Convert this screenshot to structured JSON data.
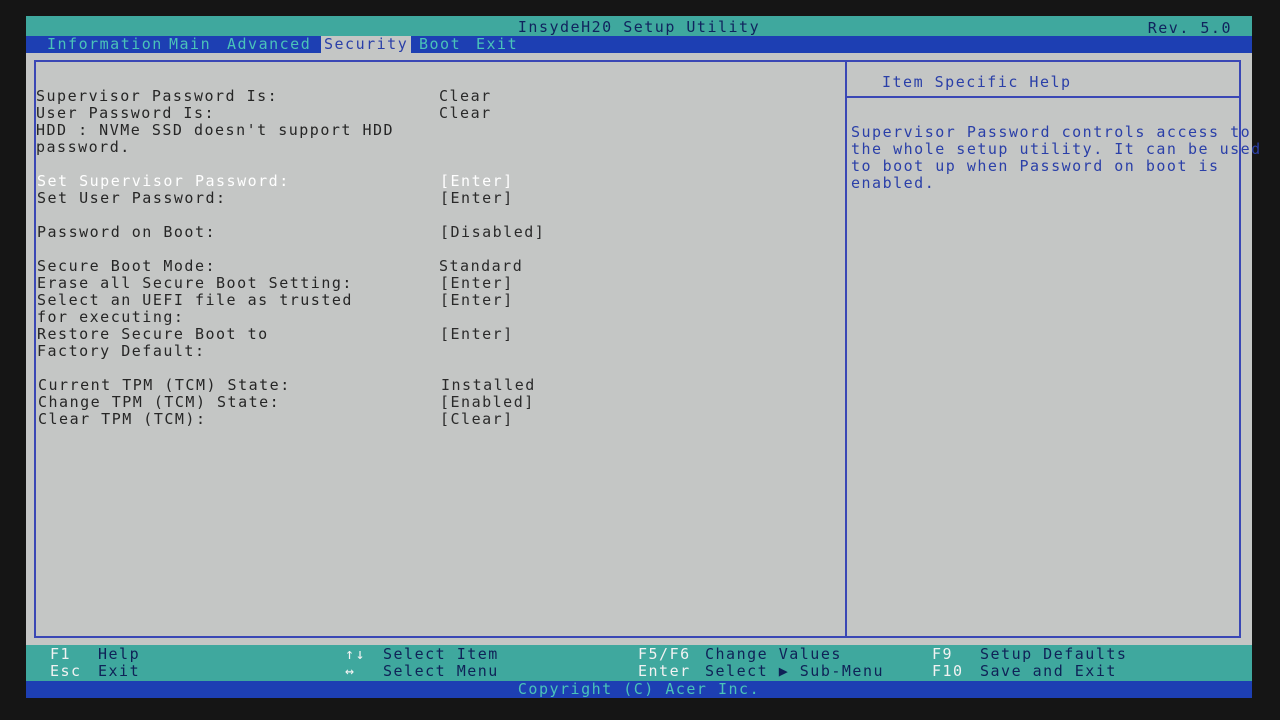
{
  "header": {
    "title": "InsydeH20 Setup Utility",
    "revision": "Rev. 5.0"
  },
  "menu": {
    "tabs": [
      {
        "label": "Information"
      },
      {
        "label": "Main"
      },
      {
        "label": "Advanced"
      },
      {
        "label": "Security"
      },
      {
        "label": "Boot"
      },
      {
        "label": "Exit"
      }
    ],
    "active": "Security"
  },
  "security": {
    "supervisor_pw_status_label": "Supervisor Password Is:",
    "supervisor_pw_status_value": "Clear",
    "user_pw_status_label": "User Password Is:",
    "user_pw_status_value": "Clear",
    "hdd_note_line1": "HDD : NVMe SSD doesn't support HDD",
    "hdd_note_line2": "password.",
    "set_supervisor_pw_label": "Set Supervisor Password:",
    "set_supervisor_pw_value": "[Enter]",
    "set_user_pw_label": "Set User Password:",
    "set_user_pw_value": "[Enter]",
    "password_on_boot_label": "Password on Boot:",
    "password_on_boot_value": "[Disabled]",
    "secure_boot_mode_label": "Secure Boot Mode:",
    "secure_boot_mode_value": "Standard",
    "erase_secure_boot_label": "Erase all Secure Boot Setting:",
    "erase_secure_boot_value": "[Enter]",
    "select_uefi_label_line1": "Select an UEFI file as trusted",
    "select_uefi_label_line2": "for executing:",
    "select_uefi_value": "[Enter]",
    "restore_secure_boot_label_line1": "Restore Secure Boot to",
    "restore_secure_boot_label_line2": "Factory Default:",
    "restore_secure_boot_value": "[Enter]",
    "current_tpm_label": "Current TPM (TCM) State:",
    "current_tpm_value": "Installed",
    "change_tpm_label": "Change TPM (TCM) State:",
    "change_tpm_value": "[Enabled]",
    "clear_tpm_label": "Clear TPM (TCM):",
    "clear_tpm_value": "[Clear]"
  },
  "help": {
    "title": "Item Specific Help",
    "lines": [
      "Supervisor Password controls access to",
      "the whole setup utility. It can be used",
      "to boot up when Password on boot is",
      "enabled."
    ]
  },
  "footer": {
    "f1_key": "F1",
    "f1_desc": "Help",
    "esc_key": "Esc",
    "esc_desc": "Exit",
    "updown_key": "↑↓",
    "updown_desc": "Select Item",
    "leftright_key": "↔",
    "leftright_desc": "Select Menu",
    "f5f6_key": "F5/F6",
    "f5f6_desc": "Change Values",
    "enter_key": "Enter",
    "enter_desc": "Select ▶ Sub-Menu",
    "f9_key": "F9",
    "f9_desc": "Setup Defaults",
    "f10_key": "F10",
    "f10_desc": "Save and Exit",
    "copyright": "Copyright (C) Acer Inc."
  },
  "colors": {
    "title_bar_bg": "#3fa89e",
    "menu_bar_bg": "#1d3fb3",
    "panel_bg": "#c4c6c5",
    "border": "#3a47b5",
    "help_text": "#2a3fa8",
    "selected_text": "#ffffff"
  }
}
